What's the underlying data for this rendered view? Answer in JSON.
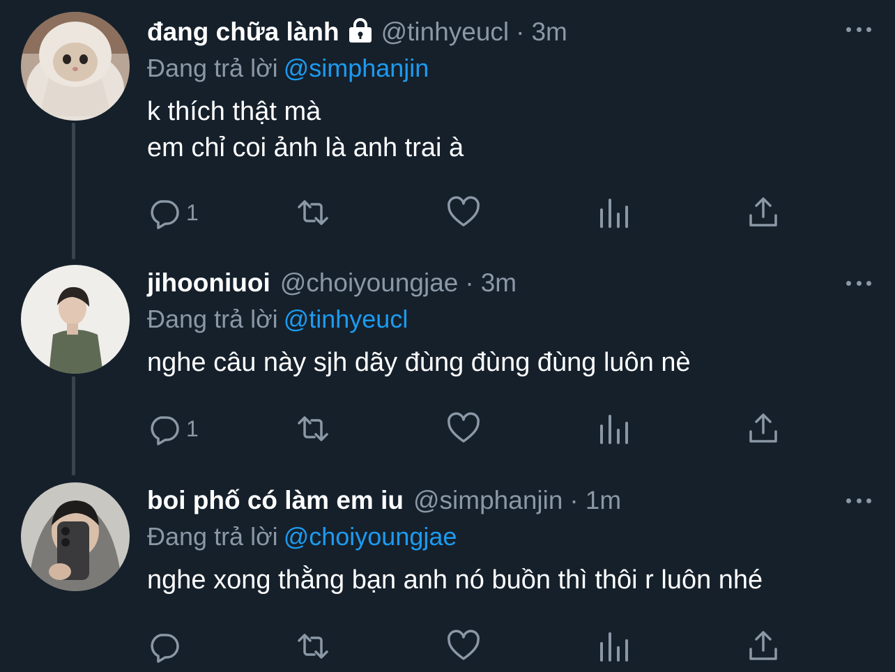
{
  "colors": {
    "background": "#15202b",
    "text_primary": "#ffffff",
    "text_secondary": "#8b98a5",
    "accent": "#1d9bf0",
    "thread_line": "#38444d"
  },
  "reply_prefix": "Đang trả lời",
  "tweets": [
    {
      "display_name": "đang chữa lành",
      "protected": true,
      "protected_icon": "lock-icon",
      "handle": "@tinhyeucl",
      "separator": "·",
      "time": "3m",
      "reply_to": "@simphanjin",
      "text_lines": [
        "k thích thật mà",
        "em chỉ coi ảnh là anh trai à"
      ],
      "avatar": "cat-wrapped-in-blanket",
      "reply_count": "1"
    },
    {
      "display_name": "jihooniuoi",
      "handle": "@choiyoungjae",
      "separator": "·",
      "time": "3m",
      "reply_to": "@tinhyeucl",
      "text_lines": [
        "nghe câu này sjh dãy đùng đùng đùng luôn nè"
      ],
      "avatar": "person-in-green-jacket",
      "reply_count": "1"
    },
    {
      "display_name": "boi phố có làm em iu",
      "handle": "@simphanjin",
      "separator": "·",
      "time": "1m",
      "reply_to": "@choiyoungjae",
      "text_lines": [
        "nghe xong thằng bạn anh nó buồn thì thôi r luôn nhé"
      ],
      "avatar": "person-mirror-selfie",
      "reply_count": ""
    }
  ],
  "action_icons": [
    "reply-icon",
    "retweet-icon",
    "like-icon",
    "analytics-icon",
    "share-icon"
  ],
  "more_icon": "more-options-icon"
}
